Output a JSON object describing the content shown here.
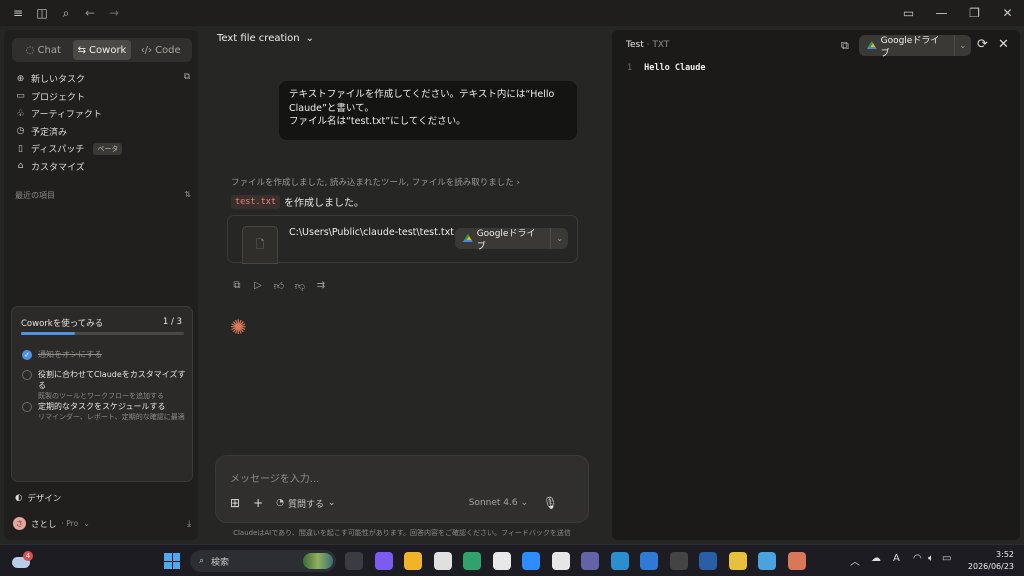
{
  "titlebar": {
    "left_icons": [
      "hamburger-menu-icon",
      "sidebar-toggle-icon",
      "search-icon",
      "back-arrow-icon",
      "forward-arrow-icon"
    ],
    "right_icons": [
      "panel-toggle-icon",
      "minimize-icon",
      "restore-icon",
      "close-icon"
    ]
  },
  "sidebar": {
    "modes": [
      {
        "label": "Chat",
        "icon": "chat-icon",
        "active": false
      },
      {
        "label": "Cowork",
        "icon": "cowork-icon",
        "active": true
      },
      {
        "label": "Code",
        "icon": "code-icon",
        "active": false
      }
    ],
    "nav": [
      {
        "label": "新しいタスク",
        "icon": "plus-icon"
      },
      {
        "label": "プロジェクト",
        "icon": "folder-icon"
      },
      {
        "label": "アーティファクト",
        "icon": "artifacts-icon"
      },
      {
        "label": "予定済み",
        "icon": "clock-icon"
      },
      {
        "label": "ディスパッチ",
        "icon": "dispatch-icon",
        "badge": "ベータ"
      },
      {
        "label": "カスタマイズ",
        "icon": "customize-icon"
      }
    ],
    "recent_header": "最近の項目",
    "try_card": {
      "title": "Coworkを使ってみる",
      "progress_text": "1 / 3",
      "progress": 0.33,
      "steps": [
        {
          "title": "通知をオンにする",
          "subtitle": "",
          "done": true
        },
        {
          "title": "役割に合わせてClaudeをカスタマイズする",
          "subtitle": "既製のツールとワークフローを追加する",
          "done": false
        },
        {
          "title": "定期的なタスクをスケジュールする",
          "subtitle": "リマインダー、レポート、定期的な確認に最適",
          "done": false
        }
      ]
    },
    "design_label": "デザイン",
    "user": {
      "name": "さとし",
      "plan": "· Pro",
      "avatar_initial": "さ"
    }
  },
  "chat": {
    "title": "Text file creation",
    "user_message_lines": [
      "テキストファイルを作成してください。テキスト内には“Hello",
      "Claude”と書いて。",
      "ファイル名は“test.txt”にしてください。"
    ],
    "tools_summary": "ファイルを作成しました, 読み込まれたツール, ファイルを読み取りました",
    "created_file_code": "test.txt",
    "created_suffix": "を作成しました。",
    "file_path": "C:\\Users\\Public\\claude-test\\test.txt",
    "gdrive_label": "Googleドライブ",
    "action_icons": [
      "copy-icon",
      "play-icon",
      "thumbs-up-icon",
      "thumbs-down-icon",
      "branch-icon"
    ],
    "composer": {
      "placeholder": "メッセージを入力...",
      "think_label": "質問する",
      "model": "Sonnet 4.6"
    },
    "disclaimer": "ClaudeはAIであり、間違いを起こす可能性があります。回答内容をご確認ください。フィードバックを送信"
  },
  "panel": {
    "title": "Test",
    "ext": "· TXT",
    "gdrive_label": "Googleドライブ",
    "lines": [
      {
        "num": "1",
        "text": "Hello Claude"
      }
    ]
  },
  "taskbar": {
    "weather_badge": "4",
    "search_label": "検索",
    "time": "3:52",
    "date": "2026/06/23",
    "apps": [
      {
        "name": "task-view-icon",
        "color": "#3b3b44"
      },
      {
        "name": "copilot-icon",
        "color": "#7c5cf0"
      },
      {
        "name": "file-explorer-icon",
        "color": "#f0b429"
      },
      {
        "name": "paint-icon",
        "color": "#e0e0e0"
      },
      {
        "name": "edge-icon",
        "color": "#2fa36b"
      },
      {
        "name": "slack-icon",
        "color": "#e8e8e8"
      },
      {
        "name": "zoom-icon",
        "color": "#2d8cff"
      },
      {
        "name": "k-app-icon",
        "color": "#e6e6e6"
      },
      {
        "name": "teams-icon",
        "color": "#6264a7"
      },
      {
        "name": "edge-dev-icon",
        "color": "#2b8fcf"
      },
      {
        "name": "vscode-icon",
        "color": "#2f7ad6"
      },
      {
        "name": "terminal-icon",
        "color": "#444"
      },
      {
        "name": "powershell-icon",
        "color": "#2a5fa8"
      },
      {
        "name": "chrome-icon",
        "color": "#e8c13c"
      },
      {
        "name": "notepad-icon",
        "color": "#4aa3df"
      },
      {
        "name": "claude-icon",
        "color": "#d97757"
      }
    ]
  }
}
